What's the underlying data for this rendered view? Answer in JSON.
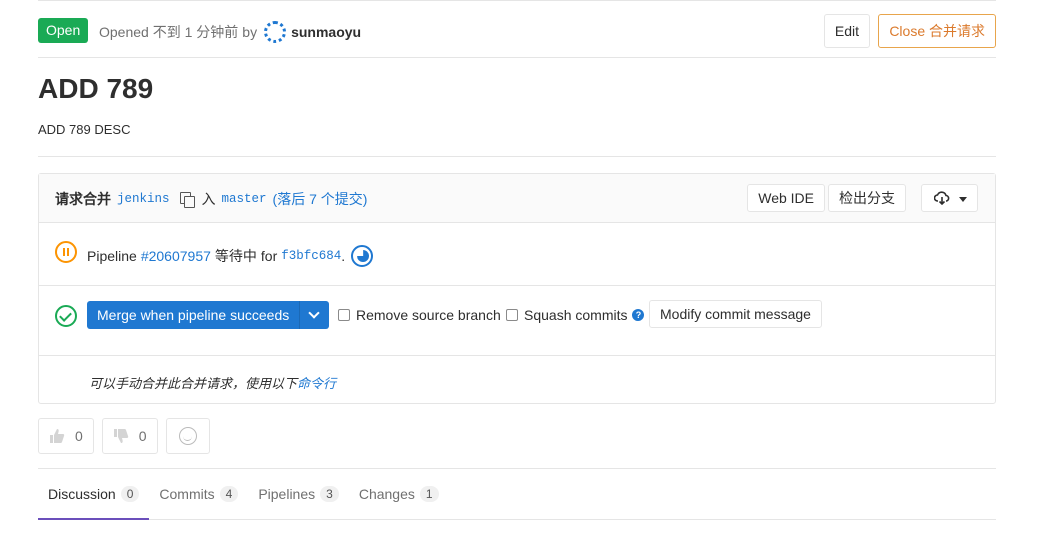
{
  "header": {
    "status": "Open",
    "opened_text": "Opened 不到 1 分钟前",
    "by": "by",
    "author": "sunmaoyu",
    "edit_label": "Edit",
    "close_label": "Close 合并请求"
  },
  "mr": {
    "title": "ADD 789",
    "description": "ADD 789 DESC"
  },
  "widget": {
    "request_label": "请求合并",
    "source_branch": "jenkins",
    "into_label": "入",
    "target_branch": "master",
    "behind_text": "(落后 7 个提交)",
    "web_ide_label": "Web IDE",
    "checkout_label": "检出分支",
    "pipeline": {
      "prefix": "Pipeline",
      "id": "#20607957",
      "status_text": "等待中",
      "for_text": "for",
      "commit": "f3bfc684",
      "suffix": "."
    },
    "merge": {
      "merge_button_label": "Merge when pipeline succeeds",
      "remove_source_label": "Remove source branch",
      "squash_label": "Squash commits",
      "modify_commit_label": "Modify commit message"
    },
    "manual": {
      "text": "可以手动合并此合并请求，使用以下",
      "link": "命令行"
    }
  },
  "awards": {
    "thumbs_up_count": "0",
    "thumbs_down_count": "0"
  },
  "tabs": [
    {
      "label": "Discussion",
      "count": "0"
    },
    {
      "label": "Commits",
      "count": "4"
    },
    {
      "label": "Pipelines",
      "count": "3"
    },
    {
      "label": "Changes",
      "count": "1"
    }
  ],
  "colors": {
    "open_green": "#1aaa55",
    "link_blue": "#1f78d1",
    "close_orange": "#db7a2c",
    "pending_orange": "#fc9403",
    "active_tab": "#6b4fbb"
  }
}
